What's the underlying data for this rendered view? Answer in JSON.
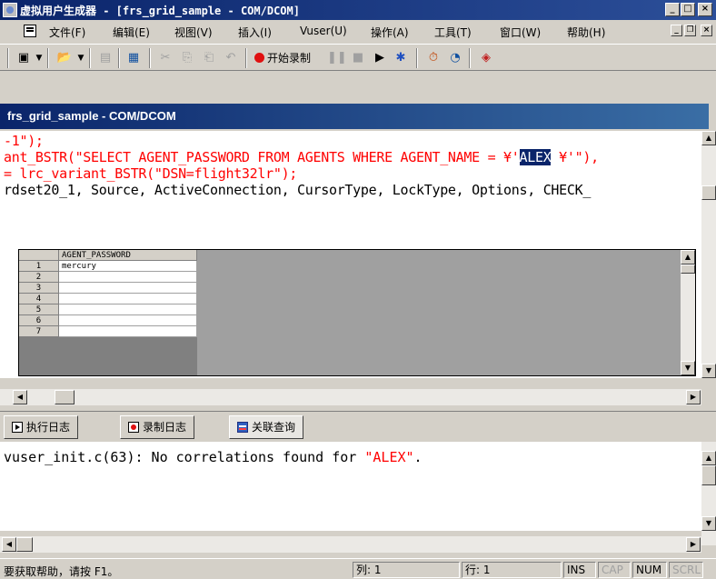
{
  "window": {
    "title": "虚拟用户生成器 - [frs_grid_sample - COM/DCOM]",
    "btn_minimize": "_",
    "btn_maximize": "□",
    "btn_close": "×"
  },
  "menu": {
    "items": [
      {
        "label": "文件(F)"
      },
      {
        "label": "编辑(E)"
      },
      {
        "label": "视图(V)"
      },
      {
        "label": "插入(I)"
      },
      {
        "label": "Vuser(U)"
      },
      {
        "label": "操作(A)"
      },
      {
        "label": "工具(T)"
      },
      {
        "label": "窗口(W)"
      },
      {
        "label": "帮助(H)"
      }
    ],
    "mdi_minimize": "_",
    "mdi_restore": "❐",
    "mdi_close": "×"
  },
  "toolbar": {
    "start_recording_label": "开始录制"
  },
  "document": {
    "title": "frs_grid_sample - COM/DCOM"
  },
  "editor": {
    "line1": "-1\");",
    "line2_prefix": "ant_BSTR(\"SELECT AGENT_PASSWORD FROM AGENTS WHERE AGENT_NAME = ¥'",
    "line2_highlight": "ALEX",
    "line2_suffix": " ¥'\"),",
    "line3": "= lrc_variant_BSTR(\"DSN=flight32lr\");",
    "line4": "rdset20_1, Source, ActiveConnection, CursorType, LockType, Options, CHECK_"
  },
  "grid": {
    "column_header": "AGENT_PASSWORD",
    "rows": [
      {
        "num": "1",
        "value": "mercury"
      },
      {
        "num": "2",
        "value": ""
      },
      {
        "num": "3",
        "value": ""
      },
      {
        "num": "4",
        "value": ""
      },
      {
        "num": "5",
        "value": ""
      },
      {
        "num": "6",
        "value": ""
      },
      {
        "num": "7",
        "value": ""
      }
    ]
  },
  "tabs": [
    {
      "label": "执行日志",
      "icon": "play-log-icon"
    },
    {
      "label": "录制日志",
      "icon": "record-log-icon"
    },
    {
      "label": "关联查询",
      "icon": "correlation-icon"
    }
  ],
  "output": {
    "prefix": "vuser_init.c(63): No correlations found for ",
    "quoted": "\"ALEX\"",
    "suffix": "."
  },
  "status": {
    "message": "要获取帮助，请按 F1。",
    "column": "列: 1",
    "line": "行: 1",
    "ins": "INS",
    "cap": "CAP",
    "num": "NUM",
    "scrl": "SCRL"
  }
}
